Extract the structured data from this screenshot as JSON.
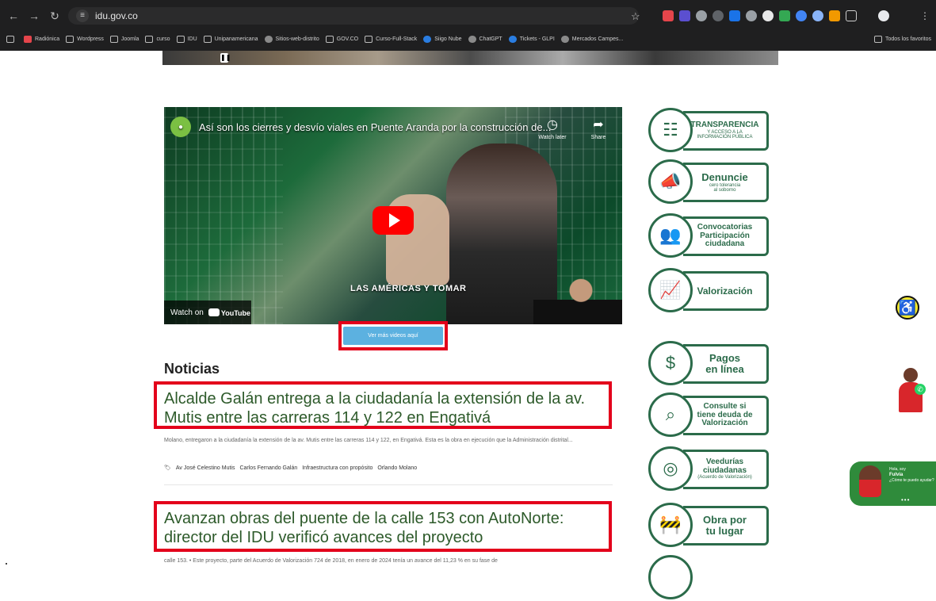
{
  "browser": {
    "url": "idu.gov.co",
    "bookmarks": [
      "Radiónica",
      "Wordpress",
      "Joomla",
      "curso",
      "IDU",
      "Unipanamericana",
      "Sitios-web-distrito",
      "GOV.CO",
      "Curso-Full-Stack",
      "Siigo Nube",
      "ChatGPT",
      "Tickets - GLPI",
      "Mercados Campes...",
      "Todos los favoritos"
    ]
  },
  "video": {
    "title": "Así son los cierres y desvío viales en Puente Aranda por la construcción de...",
    "watch_later": "Watch later",
    "share": "Share",
    "caption": "LAS AMÉRICAS Y TOMAR",
    "watch_on": "Watch on",
    "youtube": "YouTube",
    "more_button": "Ver más videos aquí"
  },
  "news": {
    "heading": "Noticias",
    "items": [
      {
        "title": "Alcalde Galán entrega a la ciudadanía la extensión de la av. Mutis entre las carreras 114 y 122 en Engativá",
        "excerpt": "Molano, entregaron a la ciudadanía la extensión de la av. Mutis entre las carreras 114 y 122, en Engativá. Esta es la obra en ejecución que la Administración distrital...",
        "tags": [
          "Av José Celestino Mutis",
          "Carlos Fernando Galán",
          "Infraestructura con propósito",
          "Orlando Molano"
        ]
      },
      {
        "title": "Avanzan obras del puente de la calle 153 con AutoNorte: director del IDU verificó avances del proyecto",
        "excerpt": "calle 153. • Este proyecto, parte del Acuerdo de Valorización 724 de 2018, en enero de 2024 tenía un avance del 11,23 % en su fase de"
      }
    ]
  },
  "sidebar": [
    {
      "lines": [
        "TRANSPARENCIA",
        "Y ACCESO A LA",
        "INFORMACIÓN PÚBLICA"
      ],
      "icon": "document-hand-icon"
    },
    {
      "lines": [
        "Denuncie",
        "cero tolerancia",
        "al soborno"
      ],
      "icon": "megaphone-icon"
    },
    {
      "lines": [
        "Convocatorias",
        "Participación",
        "ciudadana"
      ],
      "icon": "people-icon"
    },
    {
      "lines": [
        "Valorización"
      ],
      "icon": "growth-chart-icon"
    },
    {
      "lines": [
        "Pagos",
        "en línea"
      ],
      "icon": "payment-icon"
    },
    {
      "lines": [
        "Consulte si",
        "tiene deuda de",
        "Valorización"
      ],
      "icon": "search-doc-icon"
    },
    {
      "lines": [
        "Veedurías",
        "ciudadanas",
        "(Acuerdo de Valorización)"
      ],
      "icon": "inspect-icon"
    },
    {
      "lines": [
        "Obra por",
        "tu lugar"
      ],
      "icon": "construction-icon"
    }
  ],
  "chat": {
    "greeting": "Hola, soy",
    "name": "Fulvia",
    "question": "¿Cómo te puedo ayudar?",
    "dots": "•••"
  }
}
